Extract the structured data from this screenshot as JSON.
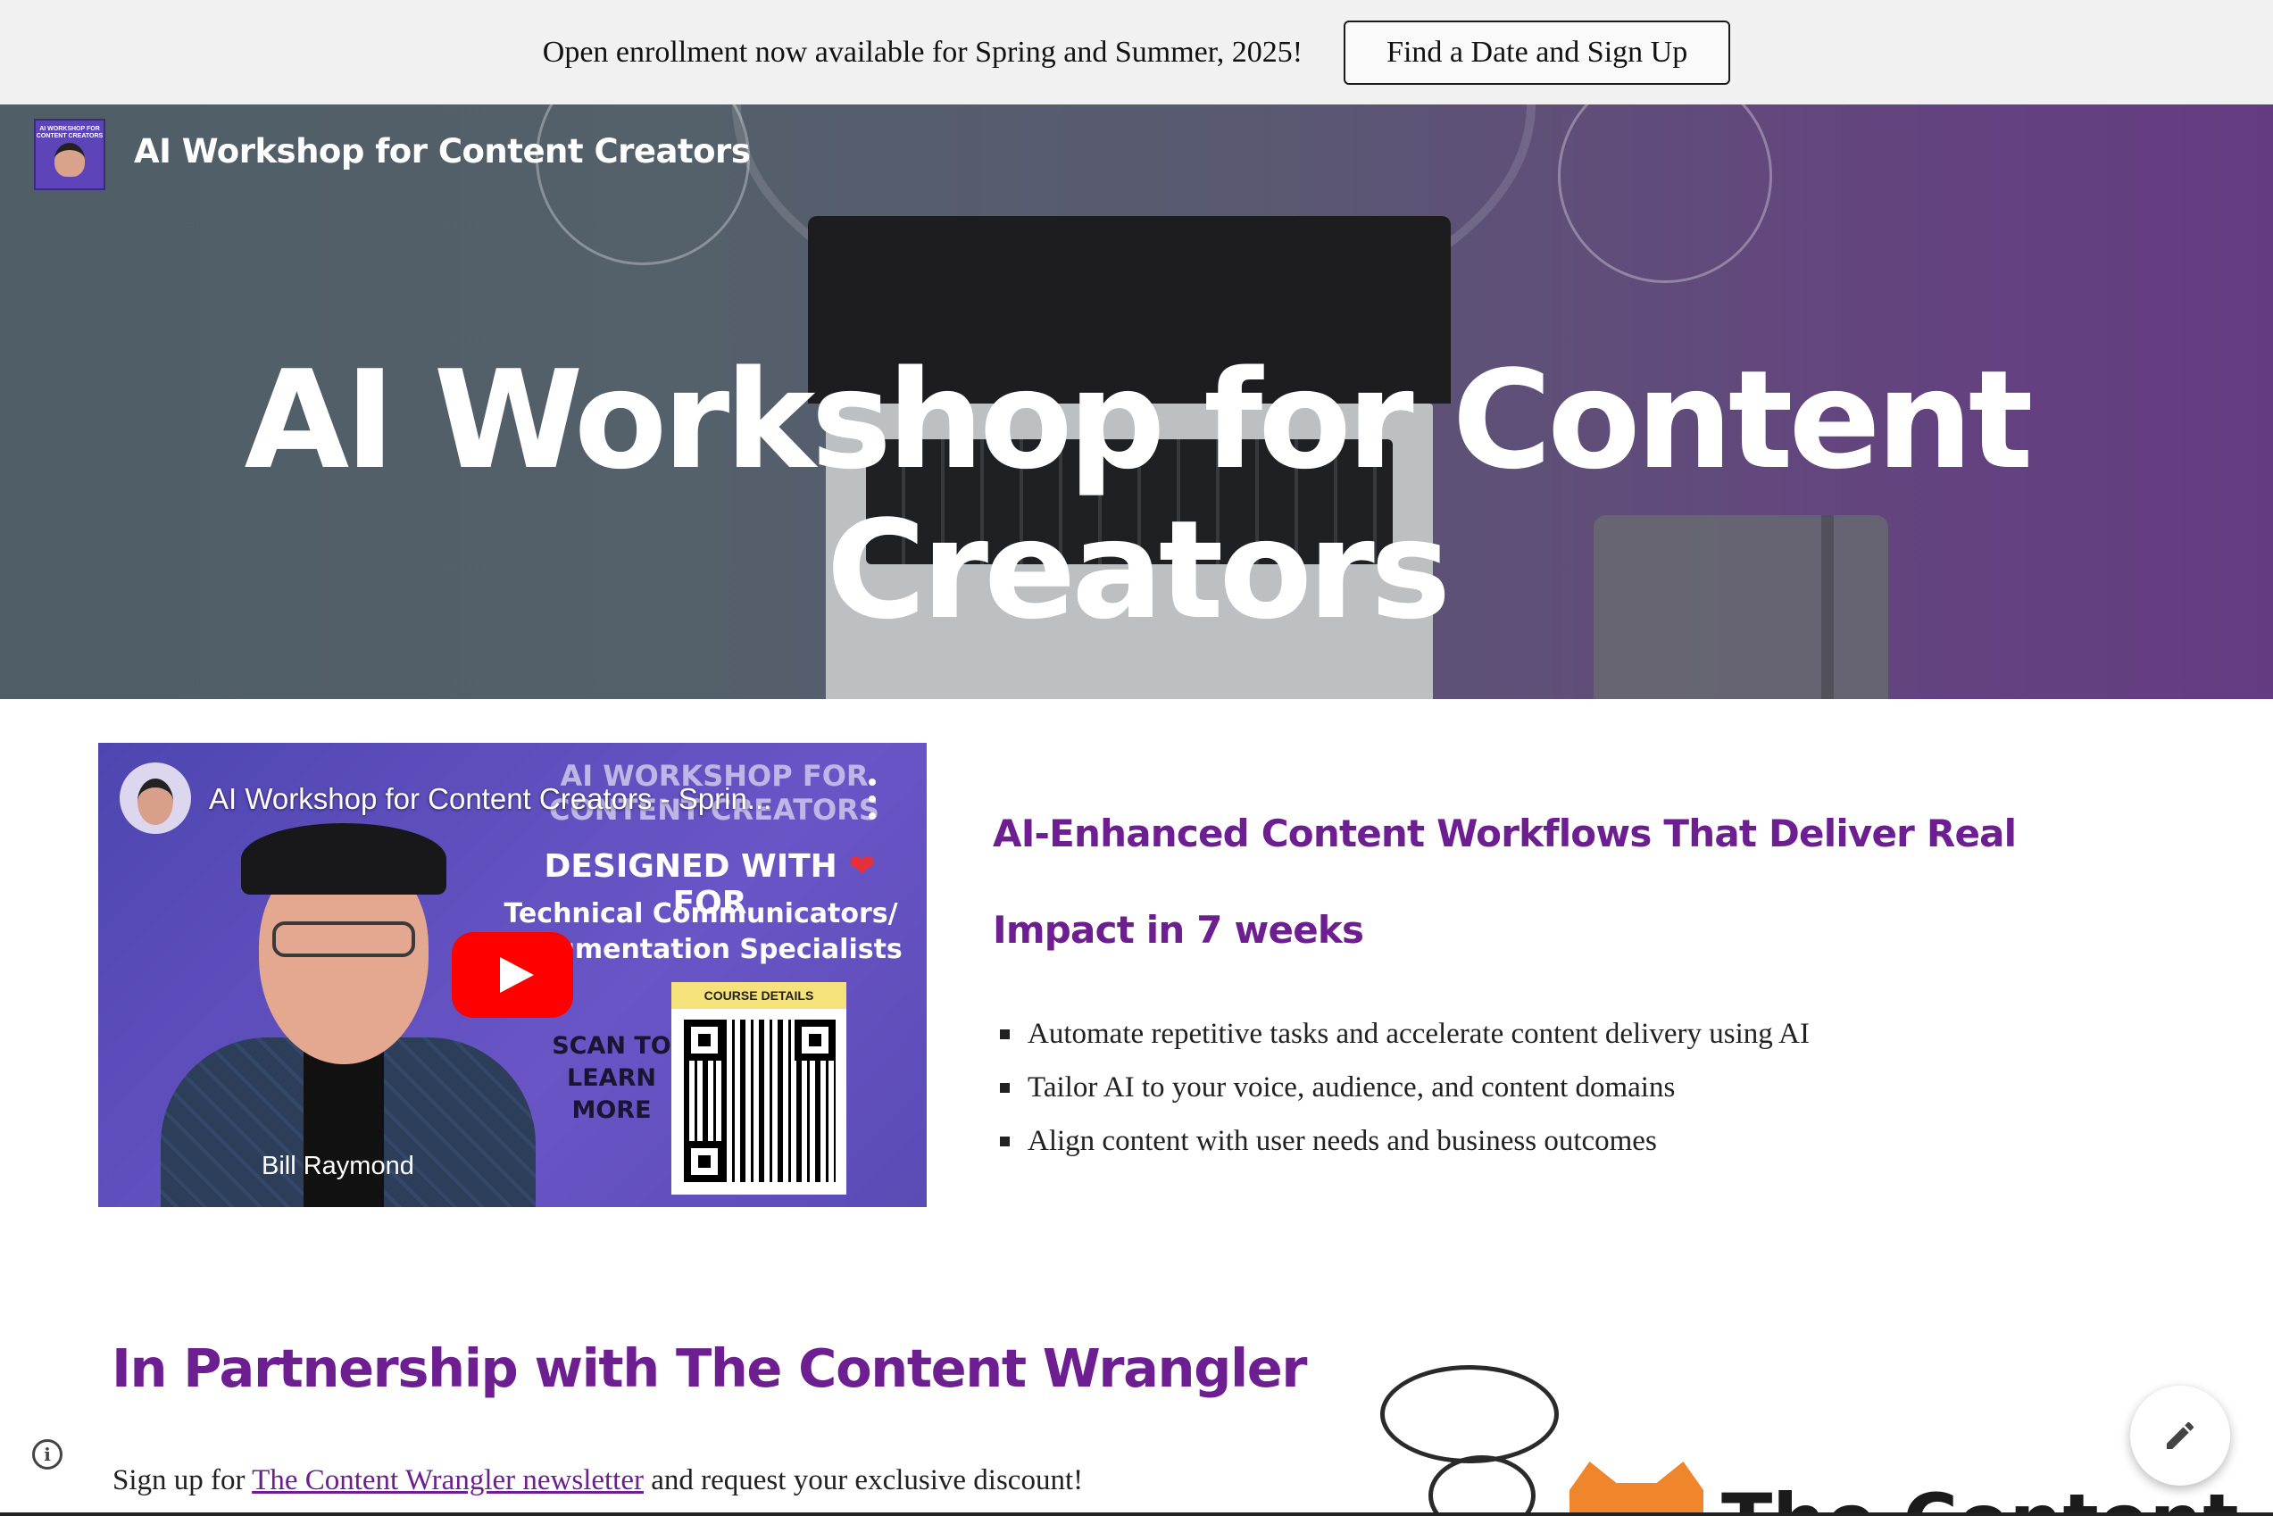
{
  "announcement": {
    "text": "Open enrollment now available for Spring and Summer, 2025!",
    "button_label": "Find a Date and Sign Up"
  },
  "site": {
    "title": "AI Workshop for Content Creators",
    "logo_text": "AI WORKSHOP FOR CONTENT CREATORS"
  },
  "hero": {
    "title_line1": "AI Workshop for Content",
    "title_line2": "Creators"
  },
  "video": {
    "title": "AI Workshop for Content Creators - Sprin...",
    "presenter": "Bill Raymond",
    "thumb_heading_line1": "AI WORKSHOP FOR",
    "thumb_heading_line2": "CONTENT CREATORS",
    "thumb_designed_prefix": "DESIGNED WITH",
    "thumb_heart": "❤",
    "thumb_designed_suffix": "FOR",
    "thumb_audience_line1": "Technical Communicators/",
    "thumb_audience_line2": "Documentation Specialists",
    "qr_label": "COURSE DETAILS",
    "scan_line1": "SCAN TO",
    "scan_line2": "LEARN",
    "scan_line3": "MORE",
    "play_icon": "play-icon"
  },
  "features": {
    "heading": "AI-Enhanced Content Workflows That Deliver Real Impact in 7 weeks",
    "bullets": [
      "Automate repetitive tasks and accelerate content delivery using AI",
      " Tailor AI to your voice, audience, and content domains",
      "Align content with user needs and business outcomes"
    ]
  },
  "partnership": {
    "heading": "In Partnership with The Content Wrangler",
    "text_prefix": "Sign up for ",
    "link_text": "The Content Wrangler newsletter",
    "text_suffix": " and request your exclusive discount!",
    "logo_word": "The Content"
  },
  "controls": {
    "info_icon": "info-icon",
    "info_glyph": "i",
    "edit_icon": "pencil-icon"
  },
  "colors": {
    "accent_purple": "#6d1f91",
    "announce_bg": "#f1f1f1",
    "youtube_red": "#ff0000",
    "thumb_purple": "#5a4bb5"
  }
}
